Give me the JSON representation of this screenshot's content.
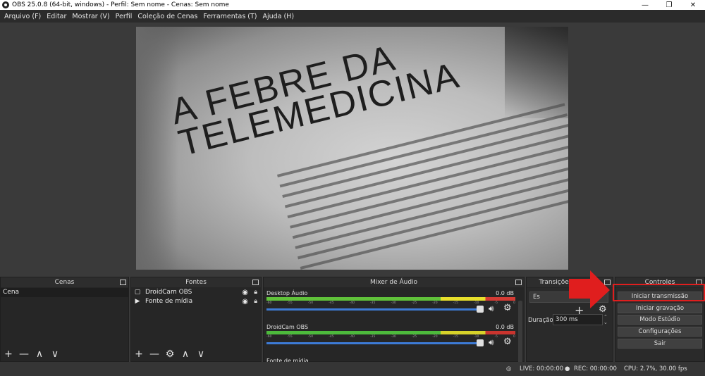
{
  "window": {
    "title": "OBS 25.0.8 (64-bit, windows) - Perfil: Sem nome - Cenas: Sem nome",
    "minimize": "—",
    "maximize": "❐",
    "close": "✕"
  },
  "menu": [
    "Arquivo (F)",
    "Editar",
    "Mostrar (V)",
    "Perfil",
    "Coleção de Cenas",
    "Ferramentas (T)",
    "Ajuda (H)"
  ],
  "preview": {
    "headline_line1": "A FEBRE DA",
    "headline_line2": "TELEMEDICINA"
  },
  "scenes": {
    "title": "Cenas",
    "items": [
      "Cena"
    ],
    "toolbar": [
      "+",
      "—",
      "∧",
      "∨"
    ]
  },
  "sources": {
    "title": "Fontes",
    "items": [
      {
        "name": "DroidCam OBS",
        "icon": "monitor-icon"
      },
      {
        "name": "Fonte de mídia",
        "icon": "play-icon"
      }
    ],
    "toolbar": [
      "+",
      "—",
      "⚙",
      "∧",
      "∨"
    ]
  },
  "mixer": {
    "title": "Mixer de Áudio",
    "ticks": [
      "-60",
      "-55",
      "-50",
      "-45",
      "-40",
      "-35",
      "-30",
      "-25",
      "-20",
      "-15",
      "-10",
      "-5",
      "0"
    ],
    "channels": [
      {
        "name": "Desktop Áudio",
        "db": "0.0 dB",
        "volume": 0.85
      },
      {
        "name": "DroidCam OBS",
        "db": "0.0 dB",
        "volume": 0.85
      },
      {
        "name": "Fonte de mídia",
        "db": "",
        "volume": 0.85
      }
    ]
  },
  "transitions": {
    "title": "Transições de Cena",
    "selected": "Es",
    "duration_label": "Duração",
    "duration_value": "300 ms"
  },
  "controls": {
    "title": "Controles",
    "buttons": [
      "Iniciar transmissão",
      "Iniciar gravação",
      "Modo Estúdio",
      "Configurações",
      "Sair"
    ]
  },
  "status": {
    "live": "LIVE: 00:00:00",
    "rec": "REC: 00:00:00",
    "cpu": "CPU: 2.7%, 30.00 fps"
  },
  "colors": {
    "highlight": "#e01e1e",
    "meter_green": "#4dba3c",
    "meter_yellow": "#d7d22a",
    "meter_red": "#c9342e",
    "slider_blue": "#3d7bd6"
  }
}
